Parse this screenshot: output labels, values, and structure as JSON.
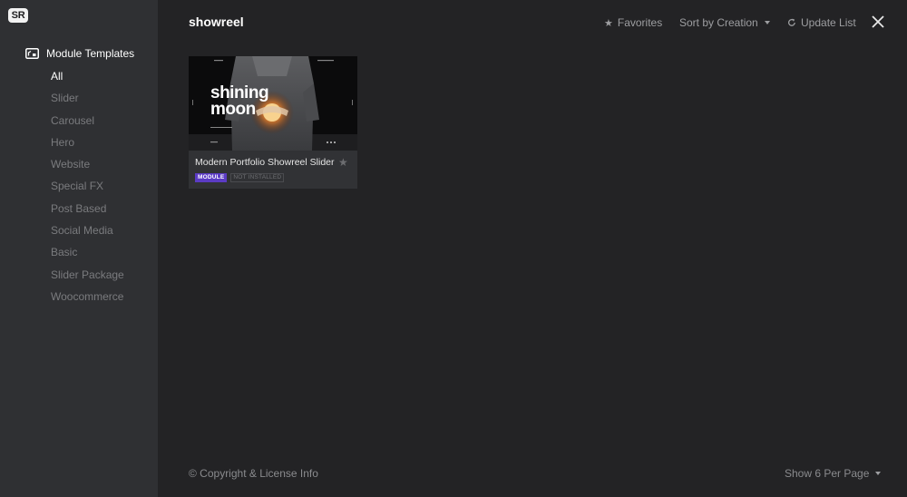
{
  "app": {
    "logo_text": "SR"
  },
  "sidebar": {
    "header_label": "Module Templates",
    "items": [
      {
        "label": "All",
        "active": true
      },
      {
        "label": "Slider"
      },
      {
        "label": "Carousel"
      },
      {
        "label": "Hero"
      },
      {
        "label": "Website"
      },
      {
        "label": "Special FX"
      },
      {
        "label": "Post Based"
      },
      {
        "label": "Social Media"
      },
      {
        "label": "Basic"
      },
      {
        "label": "Slider Package"
      },
      {
        "label": "Woocommerce"
      }
    ]
  },
  "header": {
    "search_term": "showreel",
    "favorites_label": "Favorites",
    "sort_label": "Sort by Creation",
    "update_label": "Update List"
  },
  "templates": [
    {
      "title": "Modern Portfolio Showreel Slider",
      "thumbnail_text_line1": "shining",
      "thumbnail_text_line2": "moon",
      "type_badge": "MODULE",
      "status_badge": "NOT INSTALLED"
    }
  ],
  "footer": {
    "copyright_label": "© Copyright & License Info",
    "per_page_label": "Show 6 Per Page"
  },
  "colors": {
    "background": "#232325",
    "sidebar": "#2f3033",
    "module_badge": "#5b3bc4"
  }
}
